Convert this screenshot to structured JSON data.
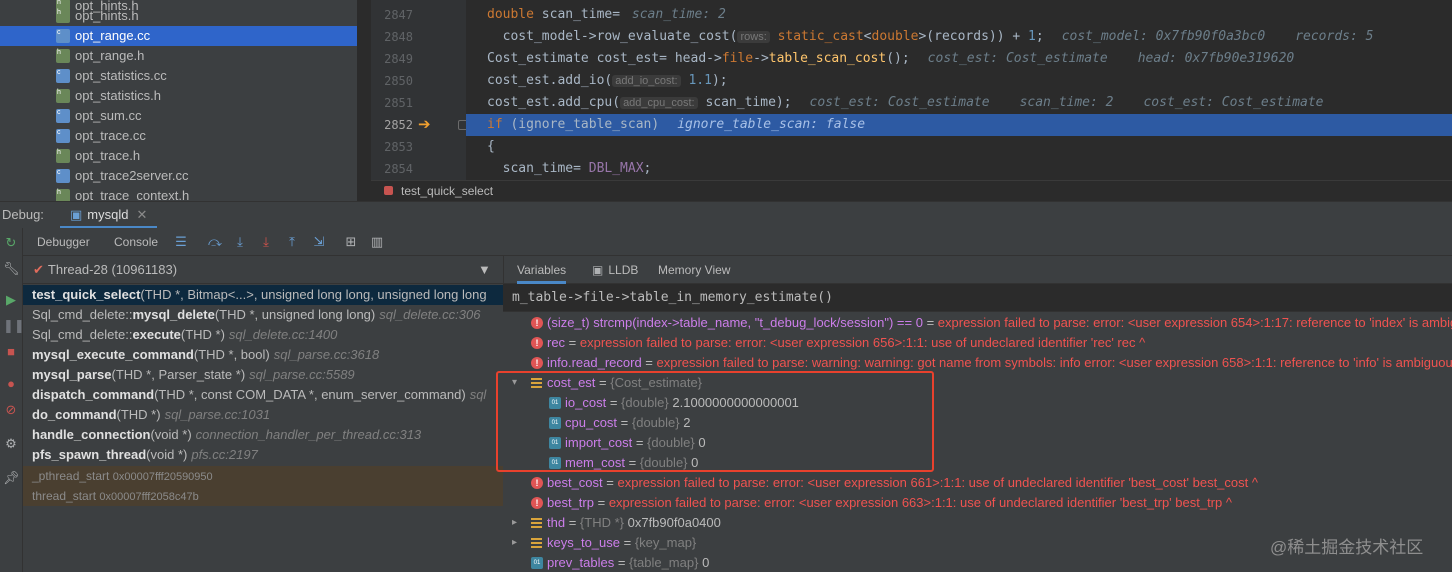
{
  "tree": {
    "items": [
      {
        "label": "opt_hints.h",
        "kind": "h"
      },
      {
        "label": "opt_range.cc",
        "kind": "cc",
        "selected": true
      },
      {
        "label": "opt_range.h",
        "kind": "h"
      },
      {
        "label": "opt_statistics.cc",
        "kind": "cc"
      },
      {
        "label": "opt_statistics.h",
        "kind": "h"
      },
      {
        "label": "opt_sum.cc",
        "kind": "cc"
      },
      {
        "label": "opt_trace.cc",
        "kind": "cc"
      },
      {
        "label": "opt_trace.h",
        "kind": "h"
      },
      {
        "label": "opt_trace2server.cc",
        "kind": "cc"
      },
      {
        "label": "opt_trace_context.h",
        "kind": "h"
      }
    ]
  },
  "editor": {
    "line_numbers": [
      "2847",
      "2848",
      "2849",
      "2850",
      "2851",
      "2852",
      "2853",
      "2854"
    ],
    "current_line": "2852",
    "breadcrumb": "test_quick_select",
    "l1_kw": "double",
    "l1_rest": " scan_time= ",
    "l1_dbg": "scan_time: 2",
    "l2_a": "cost_model->row_evaluate_cost(",
    "l2_hint": "rows:",
    "l2_b": " static_cast",
    "l2_c": "<",
    "l2_d": "double",
    "l2_e": ">(records)) + ",
    "l2_num": "1",
    "l2_f": ";",
    "l2_dbg1": "cost_model: 0x7fb90f0a3bc0",
    "l2_dbg2": "records: 5",
    "l3_a": "Cost_estimate cost_est= head->",
    "l3_b": "file",
    "l3_c": "->",
    "l3_fn": "table_scan_cost",
    "l3_d": "();",
    "l3_dbg1": "cost_est: Cost_estimate",
    "l3_dbg2": "head: 0x7fb90e319620",
    "l4_a": "cost_est.add_io(",
    "l4_hint": "add_io_cost:",
    "l4_num": " 1.1",
    "l4_b": ");",
    "l5_a": "cost_est.add_cpu(",
    "l5_hint": "add_cpu_cost:",
    "l5_b": " scan_time);",
    "l5_dbg1": "cost_est: Cost_estimate",
    "l5_dbg2": "scan_time: 2",
    "l5_dbg3": "cost_est: Cost_estimate",
    "l6_kw": "if",
    "l6_rest": " (ignore_table_scan)",
    "l6_dbg": "ignore_table_scan: false",
    "l7": "{",
    "l8_a": "  scan_time= ",
    "l8_b": "DBL_MAX",
    "l8_c": ";"
  },
  "debug": {
    "label": "Debug:",
    "session_tab": "mysqld",
    "tabs": [
      "Debugger",
      "Console"
    ],
    "thread": "Thread-28 (10961183)",
    "frames": [
      {
        "name": "test_quick_select",
        "args": "(THD *, Bitmap<...>, unsigned long long, unsigned long long",
        "loc": "",
        "selected": true
      },
      {
        "prefix": "Sql_cmd_delete::",
        "name": "mysql_delete",
        "args": "(THD *, unsigned long long)",
        "loc": "sql_delete.cc:306"
      },
      {
        "prefix": "Sql_cmd_delete::",
        "name": "execute",
        "args": "(THD *)",
        "loc": "sql_delete.cc:1400"
      },
      {
        "name": "mysql_execute_command",
        "args": "(THD *, bool)",
        "loc": "sql_parse.cc:3618"
      },
      {
        "name": "mysql_parse",
        "args": "(THD *, Parser_state *)",
        "loc": "sql_parse.cc:5589"
      },
      {
        "name": "dispatch_command",
        "args": "(THD *, const COM_DATA *, enum_server_command)",
        "loc": "sql"
      },
      {
        "name": "do_command",
        "args": "(THD *)",
        "loc": "sql_parse.cc:1031"
      },
      {
        "name": "handle_connection",
        "args": "(void *)",
        "loc": "connection_handler_per_thread.cc:313"
      },
      {
        "name": "pfs_spawn_thread",
        "args": "(void *)",
        "loc": "pfs.cc:2197"
      }
    ],
    "lib_frames": [
      {
        "name": "_pthread_start",
        "addr": "0x00007fff20590950"
      },
      {
        "name": "thread_start",
        "addr": "0x00007fff2058c47b"
      }
    ],
    "var_tabs": [
      "Variables",
      "LLDB",
      "Memory View"
    ],
    "eval_expr": "m_table->file->table_in_memory_estimate()",
    "vars": {
      "v1_name": "(size_t) strcmp(index->table_name, \"t_debug_lock/session\") == 0",
      "v1_err": "expression failed to parse: error: <user expression 654>:1:17: reference to 'index' is ambiguous",
      "v2_name": "rec",
      "v2_err": "expression failed to parse: error: <user expression 656>:1:1: use of undeclared identifier 'rec' rec ^",
      "v3_name": "info.read_record",
      "v3_err": "expression failed to parse: warning: warning: got name from symbols: info error: <user expression 658>:1:1: reference to 'info' is ambiguous",
      "v4_name": "cost_est",
      "v4_type": "{Cost_estimate}",
      "v5_name": "io_cost",
      "v5_type": "{double}",
      "v5_val": "2.1000000000000001",
      "v6_name": "cpu_cost",
      "v6_type": "{double}",
      "v6_val": "2",
      "v7_name": "import_cost",
      "v7_type": "{double}",
      "v7_val": "0",
      "v8_name": "mem_cost",
      "v8_type": "{double}",
      "v8_val": "0",
      "v9_name": "best_cost",
      "v9_err": "expression failed to parse: error: <user expression 661>:1:1: use of undeclared identifier 'best_cost' best_cost ^",
      "v10_name": "best_trp",
      "v10_err": "expression failed to parse: error: <user expression 663>:1:1: use of undeclared identifier 'best_trp' best_trp ^",
      "v11_name": "thd",
      "v11_type": "{THD *}",
      "v11_val": "0x7fb90f0a0400",
      "v12_name": "keys_to_use",
      "v12_type": "{key_map}",
      "v13_name": "prev_tables",
      "v13_type": "{table_map}",
      "v13_val": "0"
    }
  },
  "watermark": "@稀土掘金技术社区"
}
